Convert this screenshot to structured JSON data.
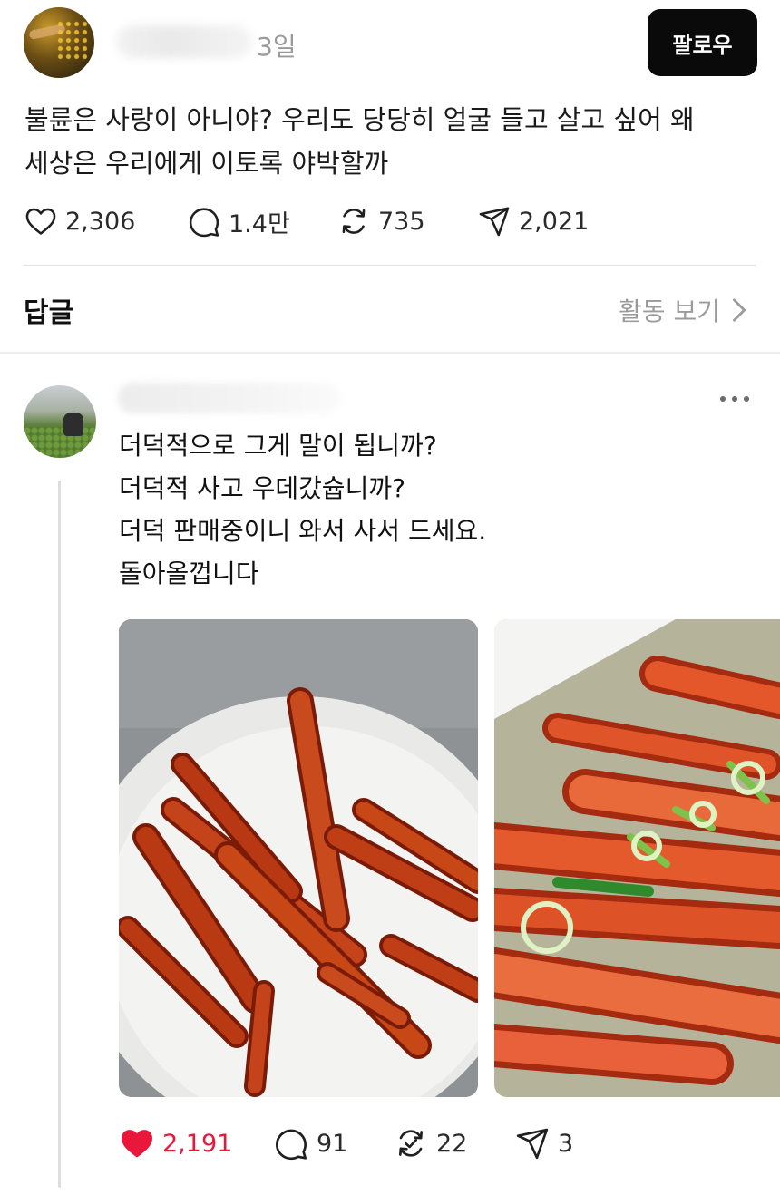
{
  "post": {
    "time": "3일",
    "follow_label": "팔로우",
    "text_line1": "불륜은 사랑이 아니야? 우리도 당당히 얼굴 들고 살고 싶어 왜",
    "text_line2": "세상은 우리에게 이토록 야박할까",
    "likes": "2,306",
    "comments": "1.4만",
    "reposts": "735",
    "shares": "2,021"
  },
  "replies_section": {
    "title": "답글",
    "activity_link": "활동 보기"
  },
  "reply": {
    "lines": [
      "더덕적으로 그게 말이 됩니까?",
      "더덕적 사고 우데갔슙니까?",
      "더덕 판매중이니 와서 사서 드세요.",
      "돌아올껍니다"
    ],
    "likes": "2,191",
    "liked": true,
    "comments": "91",
    "reposts": "22",
    "shares": "3"
  },
  "colors": {
    "accent_like": "#e8173b",
    "follow_bg": "#0a0a0a",
    "muted_text": "#9a9a9a"
  },
  "icons": [
    "heart-icon",
    "comment-icon",
    "repost-icon",
    "share-icon",
    "chevron-right-icon",
    "more-icon"
  ]
}
